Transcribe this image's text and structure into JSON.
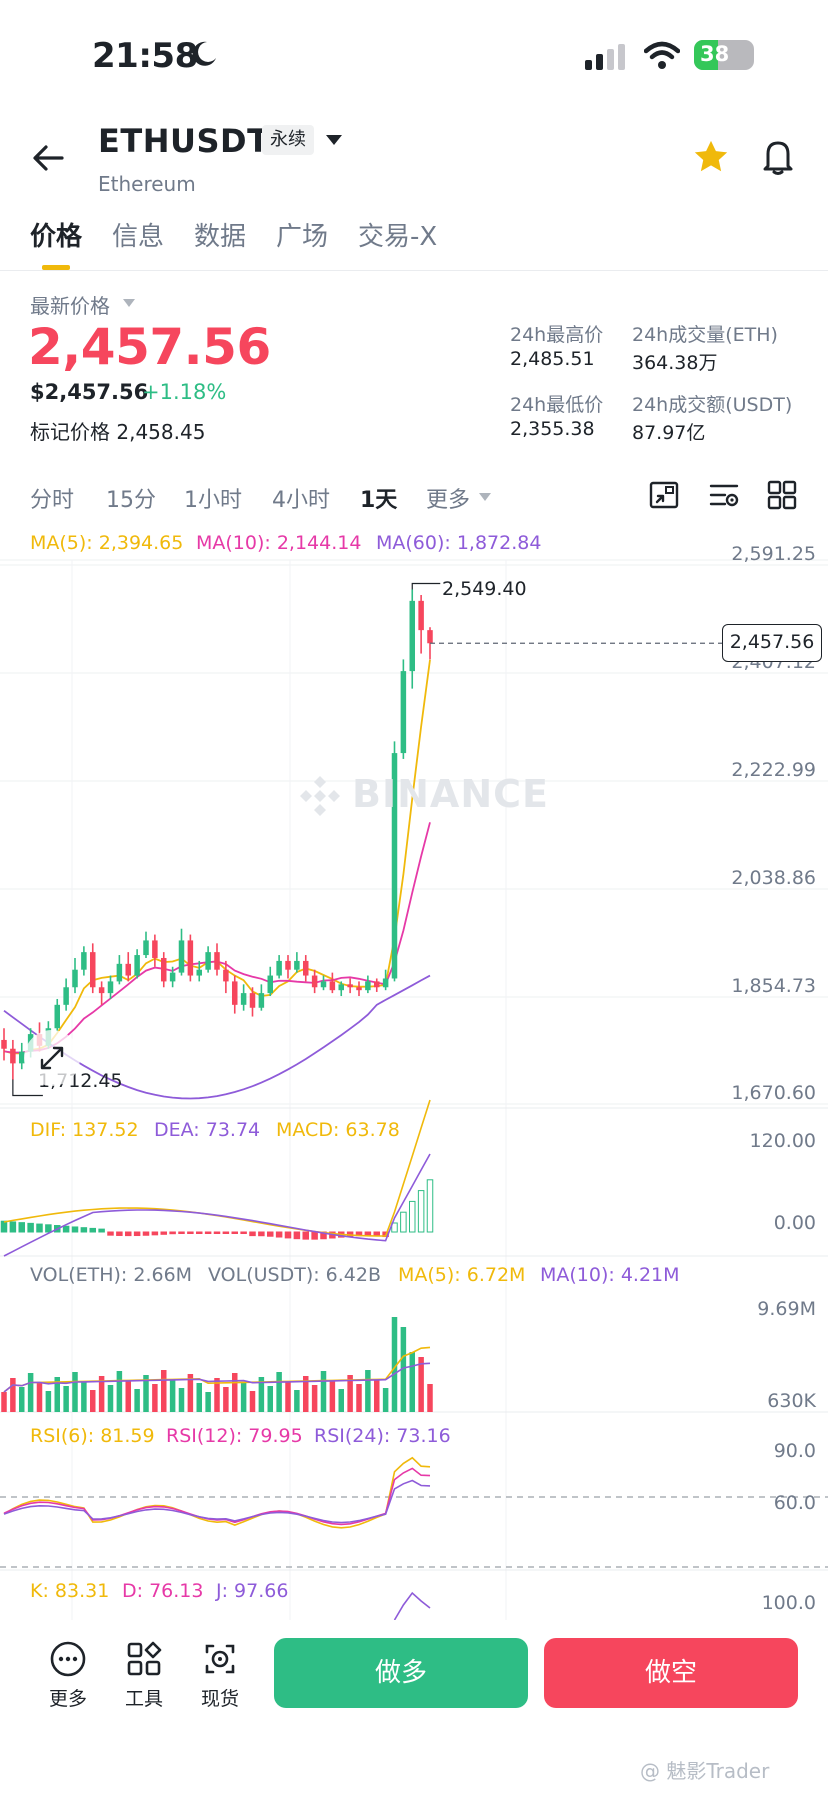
{
  "status_bar": {
    "time": "21:58",
    "battery": "38"
  },
  "header": {
    "symbol": "ETHUSDT",
    "contract_type": "永续",
    "subtitle": "Ethereum"
  },
  "tabs": [
    "价格",
    "信息",
    "数据",
    "广场",
    "交易-X"
  ],
  "price": {
    "label": "最新价格",
    "last": "2,457.56",
    "usd": "$2,457.56",
    "change": "+1.18%",
    "mark_label": "标记价格",
    "mark": "2,458.45"
  },
  "stats": {
    "high_label": "24h最高价",
    "high": "2,485.51",
    "vol_eth_label": "24h成交量(ETH)",
    "vol_eth": "364.38万",
    "low_label": "24h最低价",
    "low": "2,355.38",
    "vol_usdt_label": "24h成交额(USDT)",
    "vol_usdt": "87.97亿"
  },
  "intervals": [
    "分时",
    "15分",
    "1小时",
    "4小时",
    "1天",
    "更多"
  ],
  "active_interval": "1天",
  "indicators": {
    "ma5": "MA(5): 2,394.65",
    "ma10": "MA(10): 2,144.14",
    "ma60": "MA(60): 1,872.84",
    "dif": "DIF: 137.52",
    "dea": "DEA: 73.74",
    "macd": "MACD: 63.78",
    "vol_eth": "VOL(ETH): 2.66M",
    "vol_usdt": "VOL(USDT): 6.42B",
    "vol_ma5": "MA(5): 6.72M",
    "vol_ma10": "MA(10): 4.21M",
    "rsi6": "RSI(6): 81.59",
    "rsi12": "RSI(12): 79.95",
    "rsi24": "RSI(24): 73.16",
    "k": "K: 83.31",
    "d": "D: 76.13",
    "j": "J: 97.66"
  },
  "axis": {
    "price": [
      "2,591.25",
      "2,407.12",
      "2,222.99",
      "2,038.86",
      "1,854.73",
      "1,670.60"
    ],
    "macd": [
      "120.00",
      "0.00"
    ],
    "vol": [
      "9.69M",
      "630K"
    ],
    "rsi": [
      "90.0",
      "60.0"
    ],
    "kdj": [
      "100.0"
    ]
  },
  "chart_labels": {
    "current_price_tag": "2,457.56",
    "high_marker": "2,549.40",
    "low_marker": "1,712.45",
    "watermark": "BINANCE"
  },
  "bottom": {
    "more": "更多",
    "tools": "工具",
    "spot": "现货",
    "long": "做多",
    "short": "做空",
    "credit": "@ 魅影Trader"
  },
  "colors": {
    "up": "#2ebd85",
    "down": "#f6465d",
    "accent": "#f0b90b",
    "ma5": "#f0b90b",
    "ma10": "#e639a7",
    "ma60": "#8e5bd9"
  },
  "chart_data": {
    "type": "candlestick",
    "interval": "1天",
    "price_axis": [
      1670.6,
      1854.73,
      2038.86,
      2222.99,
      2407.12,
      2591.25
    ],
    "high_marker": 2549.4,
    "low_marker": 1712.45,
    "last_price": 2457.56,
    "candles": [
      [
        1780,
        1765,
        1800,
        1745
      ],
      [
        1765,
        1740,
        1780,
        1712
      ],
      [
        1740,
        1760,
        1775,
        1730
      ],
      [
        1760,
        1790,
        1800,
        1750
      ],
      [
        1790,
        1770,
        1810,
        1760
      ],
      [
        1770,
        1800,
        1812,
        1765
      ],
      [
        1800,
        1840,
        1850,
        1795
      ],
      [
        1840,
        1870,
        1885,
        1830
      ],
      [
        1870,
        1900,
        1920,
        1860
      ],
      [
        1900,
        1930,
        1940,
        1890
      ],
      [
        1930,
        1870,
        1945,
        1860
      ],
      [
        1870,
        1860,
        1880,
        1840
      ],
      [
        1860,
        1880,
        1890,
        1850
      ],
      [
        1880,
        1910,
        1925,
        1875
      ],
      [
        1910,
        1890,
        1930,
        1880
      ],
      [
        1890,
        1925,
        1935,
        1885
      ],
      [
        1925,
        1950,
        1965,
        1920
      ],
      [
        1950,
        1920,
        1960,
        1905
      ],
      [
        1920,
        1880,
        1930,
        1870
      ],
      [
        1880,
        1895,
        1905,
        1870
      ],
      [
        1895,
        1950,
        1970,
        1890
      ],
      [
        1950,
        1890,
        1960,
        1880
      ],
      [
        1890,
        1900,
        1915,
        1880
      ],
      [
        1900,
        1930,
        1940,
        1895
      ],
      [
        1930,
        1900,
        1945,
        1890
      ],
      [
        1900,
        1880,
        1915,
        1860
      ],
      [
        1880,
        1840,
        1890,
        1825
      ],
      [
        1840,
        1860,
        1875,
        1830
      ],
      [
        1860,
        1835,
        1870,
        1820
      ],
      [
        1835,
        1860,
        1875,
        1830
      ],
      [
        1860,
        1890,
        1905,
        1855
      ],
      [
        1890,
        1915,
        1925,
        1885
      ],
      [
        1915,
        1900,
        1925,
        1885
      ],
      [
        1900,
        1915,
        1930,
        1895
      ],
      [
        1915,
        1890,
        1925,
        1880
      ],
      [
        1890,
        1870,
        1900,
        1860
      ],
      [
        1870,
        1880,
        1890,
        1865
      ],
      [
        1880,
        1865,
        1895,
        1860
      ],
      [
        1865,
        1875,
        1880,
        1855
      ],
      [
        1875,
        1870,
        1885,
        1860
      ],
      [
        1870,
        1865,
        1880,
        1855
      ],
      [
        1865,
        1880,
        1890,
        1860
      ],
      [
        1880,
        1870,
        1885,
        1862
      ],
      [
        1870,
        1885,
        1900,
        1865
      ],
      [
        1885,
        2270,
        2290,
        1880
      ],
      [
        2270,
        2410,
        2430,
        2260
      ],
      [
        2410,
        2530,
        2549.4,
        2380
      ],
      [
        2530,
        2480,
        2540,
        2440
      ],
      [
        2480,
        2457.56,
        2485,
        2430
      ]
    ],
    "indicator_values": {
      "MA(5)": 2394.65,
      "MA(10)": 2144.14,
      "MA(60)": 1872.84,
      "DIF": 137.52,
      "DEA": 73.74,
      "MACD": 63.78,
      "VOL(ETH)": "2.66M",
      "VOL(USDT)": "6.42B",
      "VOL MA(5)": "6.72M",
      "VOL MA(10)": "4.21M",
      "RSI(6)": 81.59,
      "RSI(12)": 79.95,
      "RSI(24)": 73.16,
      "K": 83.31,
      "D": 76.13,
      "J": 97.66
    }
  }
}
